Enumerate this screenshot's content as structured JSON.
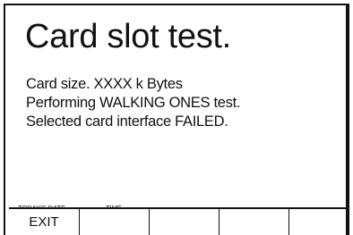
{
  "screen": {
    "title": "Card slot test.",
    "message_lines": [
      "Card size. XXXX k Bytes",
      "Performing WALKING ONES test.",
      "Selected card interface FAILED."
    ]
  },
  "status_bar": {
    "date_label": "TODAY'S DATE",
    "time_label": "TIME"
  },
  "softkeys": [
    "EXIT",
    "",
    "",
    "",
    ""
  ]
}
